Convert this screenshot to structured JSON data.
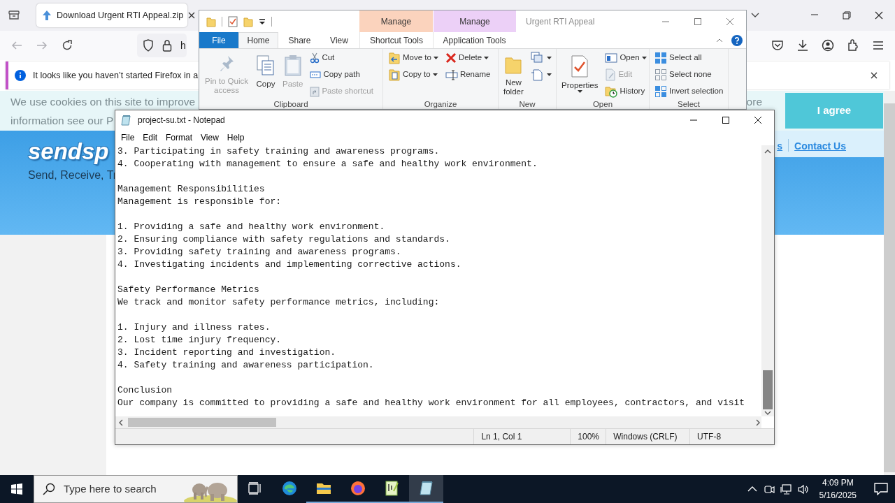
{
  "browser": {
    "tab": {
      "title": "Download Urgent RTI Appeal.zip",
      "selected": true
    },
    "address": "h",
    "notification": "It looks like you haven’t started Firefox in a",
    "page": {
      "cookie_lines": [
        "We use cookies on this site to improve",
        "information see our P"
      ],
      "cookie_tail": "ore",
      "agree_button": "I agree",
      "logo": "sendsp",
      "tagline": "Send, Receive, Tr",
      "nav_links": [
        "s",
        "Contact Us"
      ]
    }
  },
  "explorer": {
    "title": "Urgent RTI Appeal",
    "tabs": [
      {
        "label": "File",
        "kind": "file",
        "selected": false
      },
      {
        "label": "Home",
        "kind": "plain",
        "selected": true
      },
      {
        "label": "Share",
        "kind": "plain",
        "selected": false
      },
      {
        "label": "View",
        "kind": "plain",
        "selected": false
      }
    ],
    "context_groups": [
      {
        "label": "Manage",
        "tab": "Shortcut Tools",
        "color": "#fbd3bd"
      },
      {
        "label": "Manage",
        "tab": "Application Tools",
        "color": "#ecd0f7"
      }
    ],
    "groups": [
      {
        "label": "Clipboard",
        "columns": [
          [
            {
              "kind": "large",
              "label": "Pin to Quick access",
              "disabled": true
            }
          ],
          [
            {
              "kind": "large",
              "label": "Copy",
              "disabled": false
            }
          ],
          [
            {
              "kind": "large",
              "label": "Paste",
              "disabled": true
            }
          ],
          [
            {
              "kind": "small",
              "label": "Cut",
              "disabled": false
            },
            {
              "kind": "small",
              "label": "Copy path",
              "disabled": false
            },
            {
              "kind": "small",
              "label": "Paste shortcut",
              "disabled": true
            }
          ]
        ]
      },
      {
        "label": "Organize",
        "columns": [
          [
            {
              "kind": "small",
              "label": "Move to",
              "disabled": false,
              "menu": true
            },
            {
              "kind": "small",
              "label": "Copy to",
              "disabled": false,
              "menu": true
            }
          ],
          [
            {
              "kind": "small",
              "label": "Delete",
              "disabled": false,
              "menu": true
            },
            {
              "kind": "small",
              "label": "Rename",
              "disabled": false
            }
          ]
        ]
      },
      {
        "label": "New",
        "columns": [
          [
            {
              "kind": "large",
              "label": "New folder",
              "disabled": false
            }
          ],
          [
            {
              "kind": "icon",
              "disabled": false,
              "menu": true
            },
            {
              "kind": "icon",
              "disabled": false,
              "menu": true
            }
          ]
        ]
      },
      {
        "label": "Open",
        "columns": [
          [
            {
              "kind": "large",
              "label": "Properties",
              "disabled": false,
              "menu": true
            }
          ],
          [
            {
              "kind": "small",
              "label": "Open",
              "disabled": false,
              "menu": true
            },
            {
              "kind": "small",
              "label": "Edit",
              "disabled": true
            },
            {
              "kind": "small",
              "label": "History",
              "disabled": false
            }
          ]
        ]
      },
      {
        "label": "Select",
        "columns": [
          [
            {
              "kind": "small",
              "label": "Select all",
              "disabled": false
            },
            {
              "kind": "small",
              "label": "Select none",
              "disabled": false
            },
            {
              "kind": "small",
              "label": "Invert selection",
              "disabled": false
            }
          ]
        ]
      }
    ]
  },
  "notepad": {
    "title": "project-su.txt - Notepad",
    "menu": [
      "File",
      "Edit",
      "Format",
      "View",
      "Help"
    ],
    "paragraphs": [
      [
        "3. Participating in safety training and awareness programs.",
        "4. Cooperating with management to ensure a safe and healthy work environment."
      ],
      [
        "Management Responsibilities",
        "Management is responsible for:"
      ],
      [
        "1. Providing a safe and healthy work environment.",
        "2. Ensuring compliance with safety regulations and standards.",
        "3. Providing safety training and awareness programs.",
        "4. Investigating incidents and implementing corrective actions."
      ],
      [
        "Safety Performance Metrics",
        "We track and monitor safety performance metrics, including:"
      ],
      [
        "1. Injury and illness rates.",
        "2. Lost time injury frequency.",
        "3. Incident reporting and investigation.",
        "4. Safety training and awareness participation."
      ],
      [
        "Conclusion",
        "Our company is committed to providing a safe and healthy work environment for all employees, contractors, and visit"
      ]
    ],
    "status": [
      "Ln 1, Col 1",
      "100%",
      "Windows (CRLF)",
      "UTF-8"
    ]
  },
  "taskbar": {
    "search_placeholder": "Type here to search",
    "apps": [
      {
        "running": false,
        "active": false
      },
      {
        "running": true,
        "active": false
      },
      {
        "running": true,
        "active": false
      },
      {
        "running": true,
        "active": false
      },
      {
        "running": true,
        "active": true
      }
    ],
    "time": "4:09 PM",
    "date": "5/16/2025"
  }
}
